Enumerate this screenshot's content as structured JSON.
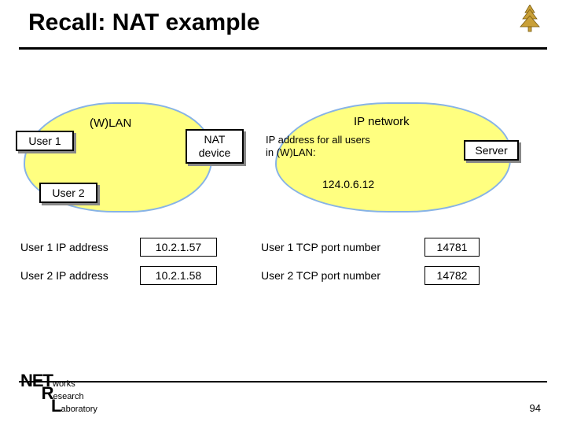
{
  "title": "Recall: NAT example",
  "diagram": {
    "cloud_left_label": "(W)LAN",
    "cloud_right_label": "IP network",
    "user1": "User 1",
    "user2": "User 2",
    "nat_line1": "NAT",
    "nat_line2": "device",
    "server": "Server",
    "ip_text_line1": "IP address for all users",
    "ip_text_line2": "in (W)LAN:",
    "nat_ip": "124.0.6.12"
  },
  "table": {
    "rows": [
      {
        "label_left": "User 1 IP address",
        "val_left": "10.2.1.57",
        "label_right": "User 1 TCP port number",
        "val_right": "14781"
      },
      {
        "label_left": "User 2 IP address",
        "val_left": "10.2.1.58",
        "label_right": "User 2 TCP port number",
        "val_right": "14782"
      }
    ]
  },
  "footer": {
    "logo_prefix": "NET",
    "logo_line1": "works",
    "logo_line2": "esearch",
    "logo_mid": "R",
    "logo_line3": "aboratory",
    "logo_mid2": "L",
    "page": "94"
  }
}
